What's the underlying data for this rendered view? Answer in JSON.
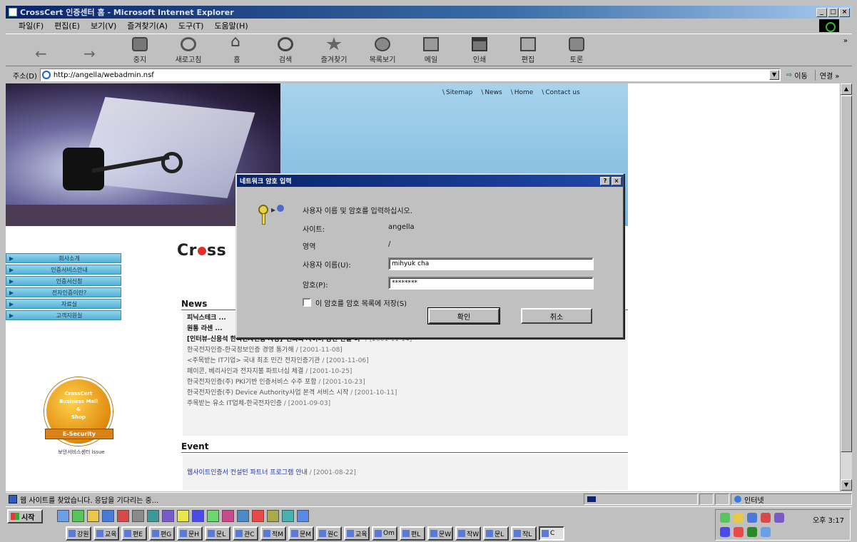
{
  "window": {
    "title": "CrossCert 인증센터 홈 - Microsoft Internet Explorer",
    "controls": [
      "_",
      "□",
      "×"
    ]
  },
  "menu": [
    "파일(F)",
    "편집(E)",
    "보기(V)",
    "즐겨찾기(A)",
    "도구(T)",
    "도움말(H)"
  ],
  "toolbar": {
    "buttons": [
      {
        "label": "",
        "icon": "back-arrow-icon"
      },
      {
        "label": "",
        "icon": "forward-arrow-icon"
      },
      {
        "label": "중지",
        "icon": "stop-icon"
      },
      {
        "label": "새로고침",
        "icon": "refresh-icon"
      },
      {
        "label": "홈",
        "icon": "home-icon"
      },
      {
        "label": "검색",
        "icon": "search-icon"
      },
      {
        "label": "즐겨찾기",
        "icon": "favorites-icon"
      },
      {
        "label": "목록보기",
        "icon": "history-icon"
      },
      {
        "label": "메일",
        "icon": "mail-icon"
      },
      {
        "label": "인쇄",
        "icon": "print-icon"
      },
      {
        "label": "편집",
        "icon": "edit-icon"
      },
      {
        "label": "토론",
        "icon": "discuss-icon"
      }
    ],
    "more": "»"
  },
  "address": {
    "label": "주소(D)",
    "url": "http://angella/webadmin.nsf",
    "go": "이동",
    "links": "연결 »"
  },
  "page": {
    "topnav": [
      "Sitemap",
      "News",
      "Home",
      "Contact us"
    ],
    "logo_prefix": "Cr",
    "logo_suffix": "ss",
    "sidemenu": [
      "회사소개",
      "인증서비스안내",
      "인증서신청",
      "전자인증이란?",
      "자료실",
      "고객지원실"
    ],
    "badge": {
      "line1": "CrossCert",
      "line2": "Business Mall",
      "line3": "&",
      "line4": "Shop",
      "ribbon": "E-Security",
      "caption": "보안서비스센터 Issue"
    },
    "news_title": "News",
    "news": [
      {
        "text": "피닉스테크 ...",
        "date": "",
        "bold": true
      },
      {
        "text": "원통 라센 ...",
        "date": "",
        "bold": true
      },
      {
        "text": "[인터뷰-신용석 한국전자인증 사장]\"신뢰의 사이버 공간 만들 터\"",
        "date": " / [2001-11-14]",
        "bold": true
      },
      {
        "text": "한국전자인증-한국정보인증 경영 통가해",
        "date": " / [2001-11-08]",
        "bold": false
      },
      {
        "text": "<주목받는 IT기업> 국내 최초 민간 전자인증기관",
        "date": " / [2001-11-06]",
        "bold": false
      },
      {
        "text": "페이콘, 베리사인과 전자지불 파트너십 체결",
        "date": " / [2001-10-25]",
        "bold": false
      },
      {
        "text": "한국전자인증(주) PKI기반 인증서비스 수주 포함",
        "date": " / [2001-10-23]",
        "bold": false
      },
      {
        "text": "한국전자인증(주) Device Authority사업 본격 서비스 시작",
        "date": " / [2001-10-11]",
        "bold": false
      },
      {
        "text": "주목받는 유소 IT업체-한국전자인증",
        "date": " / [2001-09-03]",
        "bold": false
      }
    ],
    "event_title": "Event",
    "event": {
      "text": "웹사이트인증서 컨설턴 파트너 프로그램 안내",
      "date": " / [2001-08-22]"
    }
  },
  "dialog": {
    "title": "네트워크 암호 입력",
    "buttons": [
      "?",
      "×"
    ],
    "prompt": "사용자 이름 및 암호를 입력하십시오.",
    "site_label": "사이트:",
    "site_value": "angella",
    "realm_label": "영역",
    "realm_value": "/",
    "user_label": "사용자 이름(U):",
    "user_value": "mihyuk cha",
    "pass_label": "암호(P):",
    "pass_value": "********",
    "save_label": "이 암호를 암호 목록에 저장(S)",
    "save_checked": false,
    "ok": "확인",
    "cancel": "취소"
  },
  "status": {
    "text": "웹 사이트를 찾았습니다. 응답을 기다리는 중...",
    "zone": "인터넷"
  },
  "taskbar": {
    "start": "시작",
    "tasks": [
      "강원",
      "교육",
      "편E",
      "편G",
      "문H",
      "문L",
      "관C",
      "적M",
      "문M",
      "원C",
      "교육",
      "Om",
      "편L",
      "문W",
      "작W",
      "문L",
      "작L",
      "C"
    ],
    "clock": "오후 3:17"
  }
}
